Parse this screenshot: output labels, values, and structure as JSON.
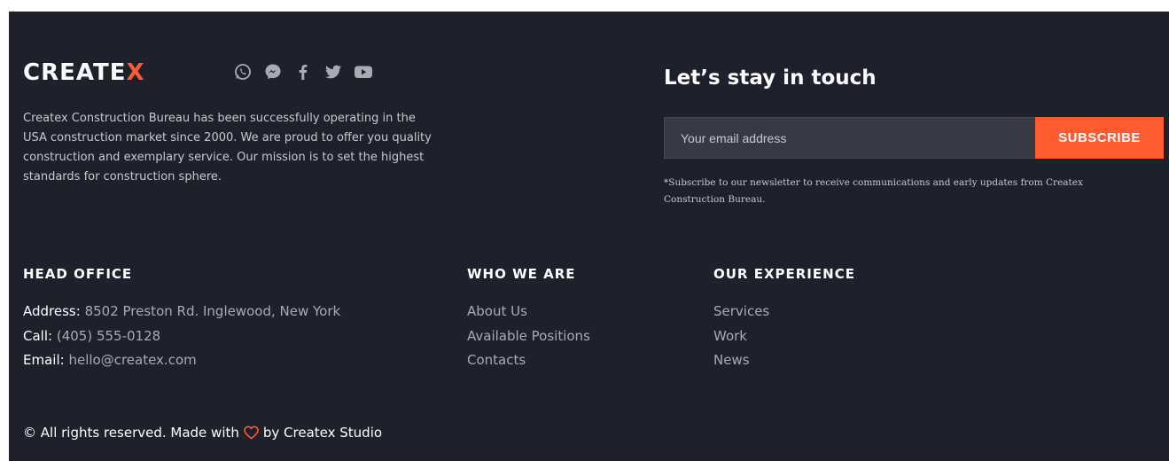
{
  "brand": {
    "name_prefix": "CREATE",
    "name_accent": "X",
    "accent_color": "#ff5a30",
    "background_color": "#1e212c"
  },
  "socials": [
    {
      "icon": "whatsapp-icon"
    },
    {
      "icon": "messenger-icon"
    },
    {
      "icon": "facebook-icon"
    },
    {
      "icon": "twitter-icon"
    },
    {
      "icon": "youtube-icon"
    }
  ],
  "about_text": "Createx Construction Bureau has been successfully operating in the USA construction market since 2000. We are proud to offer you quality construction and exemplary service. Our mission is to set the highest standards for construction sphere.",
  "newsletter": {
    "title": "Let’s stay in touch",
    "placeholder": "Your email address",
    "button_label": "SUBSCRIBE",
    "note": "*Subscribe to our newsletter to receive communications and early updates from Createx Construction Bureau."
  },
  "head_office": {
    "title": "HEAD OFFICE",
    "address_label": "Address:",
    "address_value": "8502 Preston Rd. Inglewood, New York",
    "call_label": "Call:",
    "call_value": "(405) 555-0128",
    "email_label": "Email:",
    "email_value": "hello@createx.com"
  },
  "who_we_are": {
    "title": "WHO WE ARE",
    "links": [
      "About Us",
      "Available Positions",
      "Contacts"
    ]
  },
  "our_experience": {
    "title": "OUR EXPERIENCE",
    "links": [
      "Services",
      "Work",
      "News"
    ]
  },
  "copyright": {
    "before": "© All rights reserved. Made with",
    "after": "by Createx Studio",
    "icon": "heart-icon"
  }
}
